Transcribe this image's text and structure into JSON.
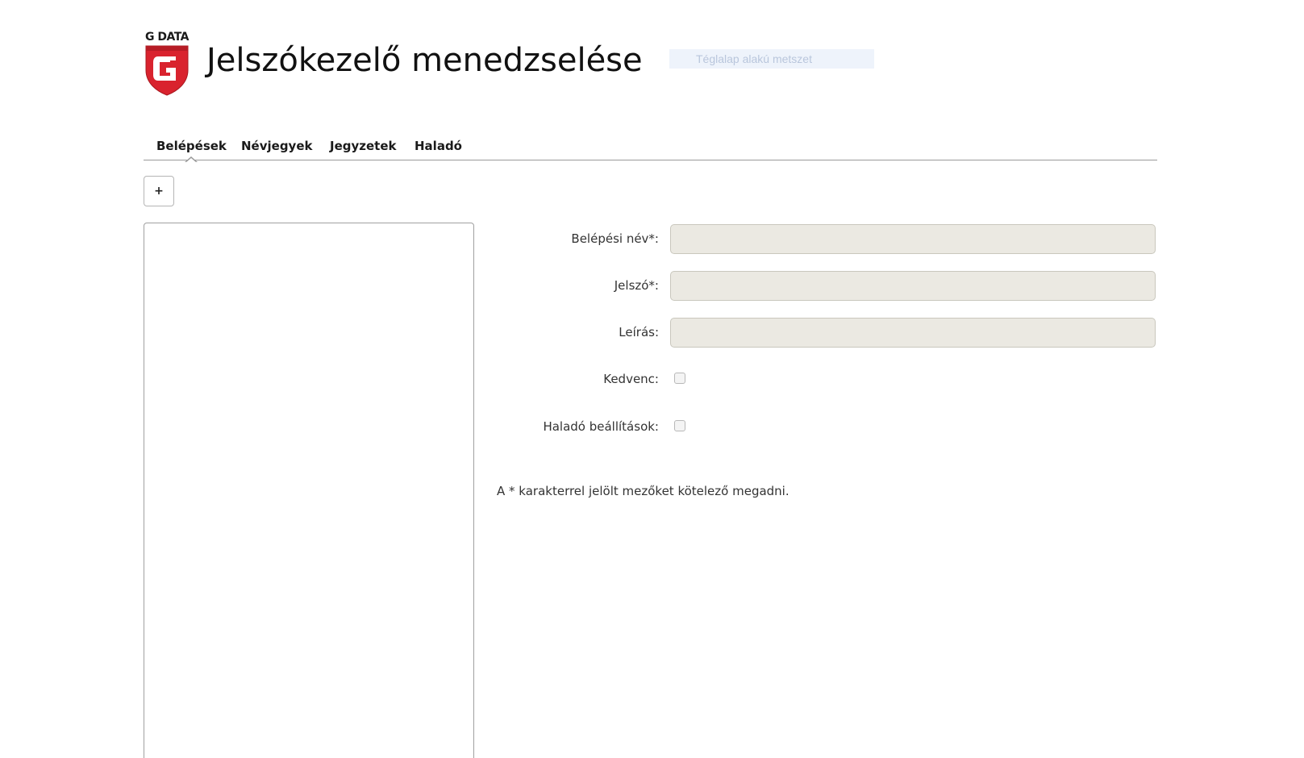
{
  "header": {
    "logo_text": "G DATA",
    "title": "Jelszókezelő menedzselése",
    "snip_overlay_text": "Téglalap alakú metszet"
  },
  "tabs": [
    {
      "label": "Belépések",
      "active": true
    },
    {
      "label": "Névjegyek",
      "active": false
    },
    {
      "label": "Jegyzetek",
      "active": false
    },
    {
      "label": "Haladó",
      "active": false
    }
  ],
  "toolbar": {
    "add_label": "+"
  },
  "form": {
    "login_name_label": "Belépési név*:",
    "login_name_value": "",
    "password_label": "Jelszó*:",
    "password_value": "",
    "description_label": "Leírás:",
    "description_value": "",
    "favorite_label": "Kedvenc:",
    "favorite_checked": false,
    "advanced_label": "Haladó beállítások:",
    "advanced_checked": false,
    "required_note": "A * karakterrel jelölt mezőket kötelező megadni."
  },
  "colors": {
    "brand_red": "#d9232e",
    "input_bg": "#ebe9e2",
    "divider": "#9a9a9a"
  },
  "icons": {
    "logo": "gdata-shield-logo-icon"
  }
}
